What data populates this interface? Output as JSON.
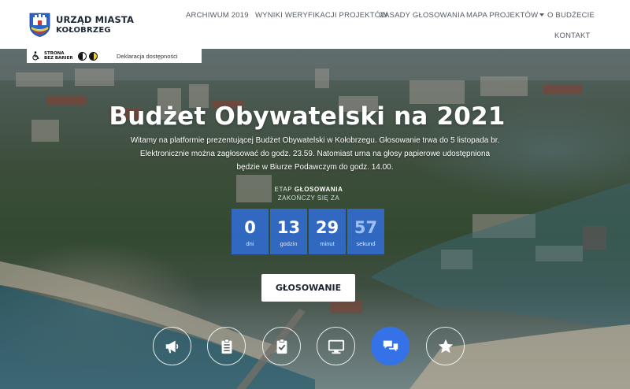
{
  "header": {
    "logo_line1": "URZĄD MIASTA",
    "logo_line2": "KOŁOBRZEG",
    "nav": [
      {
        "id": "archiwum",
        "label": "ARCHIWUM 2019"
      },
      {
        "id": "wyniki",
        "label": "WYNIKI WERYFIKACJI PROJEKTÓW"
      },
      {
        "id": "zasady",
        "label": "ZASADY GŁOSOWANIA"
      },
      {
        "id": "mapa",
        "label": "MAPA PROJEKTÓW"
      },
      {
        "id": "budzet",
        "label": "O BUDŻECIE"
      },
      {
        "id": "kontakt",
        "label": "KONTAKT"
      }
    ]
  },
  "accessibility": {
    "badge_line1": "STRONA",
    "badge_line2": "BEZ BARIER",
    "declaration_link": "Deklaracja dostępności"
  },
  "hero": {
    "title": "Budżet Obywatelski na 2021",
    "intro": "Witamy na platformie prezentującej Budżet Obywatelski w Kołobrzegu. Głosowanie trwa do 5 listopada br. Elektronicznie można zagłosować do godz. 23.59. Natomiast urna na głosy papierowe udostępniona będzie w Biurze Podawczym do godz. 14.00.",
    "stage_prefix": "ETAP ",
    "stage_name": "GŁOSOWANIA",
    "stage_sub": "ZAKOŃCZY SIĘ ZA",
    "countdown": [
      {
        "value": "0",
        "unit": "dni"
      },
      {
        "value": "13",
        "unit": "godzin"
      },
      {
        "value": "29",
        "unit": "minut"
      },
      {
        "value": "57",
        "unit": "sekund"
      }
    ],
    "vote_button": "GŁOSOWANIE"
  },
  "icons": [
    {
      "name": "megaphone-icon",
      "active": false
    },
    {
      "name": "clipboard-list-icon",
      "active": false
    },
    {
      "name": "clipboard-check-icon",
      "active": false
    },
    {
      "name": "monitor-icon",
      "active": false
    },
    {
      "name": "comments-icon",
      "active": true
    },
    {
      "name": "star-icon",
      "active": false
    }
  ],
  "colors": {
    "accent": "#3572e8",
    "countdown_bg": "#3171e8"
  }
}
